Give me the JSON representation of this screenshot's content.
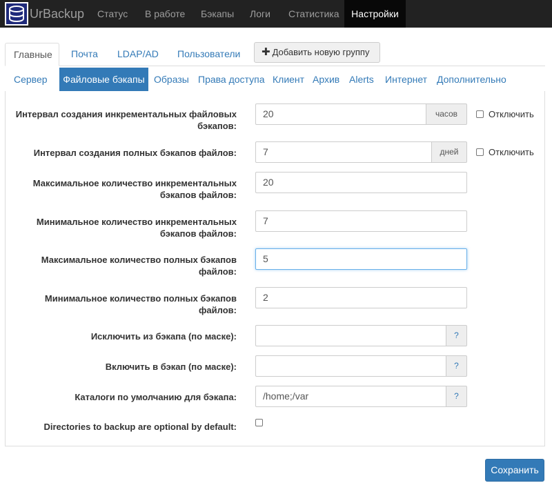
{
  "app": {
    "brand": "UrBackup"
  },
  "nav": {
    "items": [
      {
        "label": "Статус"
      },
      {
        "label": "В работе"
      },
      {
        "label": "Бэкапы"
      },
      {
        "label": "Логи"
      },
      {
        "label": "Статистика"
      },
      {
        "label": "Настройки",
        "active": true
      }
    ]
  },
  "tabs": [
    {
      "label": "Главные",
      "active": true
    },
    {
      "label": "Почта"
    },
    {
      "label": "LDAP/AD"
    },
    {
      "label": "Пользователи"
    }
  ],
  "add_group_button": {
    "label": "Добавить новую группу",
    "icon": "plus-icon"
  },
  "subtabs": [
    {
      "label": "Сервер"
    },
    {
      "label": "Файловые бэкапы",
      "active": true
    },
    {
      "label": "Образы"
    },
    {
      "label": "Права доступа"
    },
    {
      "label": "Клиент"
    },
    {
      "label": "Архив"
    },
    {
      "label": "Alerts"
    },
    {
      "label": "Интернет"
    },
    {
      "label": "Дополнительно"
    }
  ],
  "form": {
    "incr_interval": {
      "label_line1": "Интервал создания инкрементальных файловых",
      "label_line2": "бэкапов:",
      "value": "20",
      "unit": "часов",
      "disable_label": "Отключить",
      "disabled": false
    },
    "full_interval": {
      "label": "Интервал создания полных бэкапов файлов:",
      "value": "7",
      "unit": "дней",
      "disable_label": "Отключить",
      "disabled": false
    },
    "max_incr": {
      "label_line1": "Максимальное количество инкрементальных",
      "label_line2": "бэкапов файлов:",
      "value": "20"
    },
    "min_incr": {
      "label_line1": "Минимальное количество инкрементальных",
      "label_line2": "бэкапов файлов:",
      "value": "7"
    },
    "max_full": {
      "label_line1": "Максимальное количество полных бэкапов",
      "label_line2": "файлов:",
      "value": "5"
    },
    "min_full": {
      "label_line1": "Минимальное количество полных бэкапов",
      "label_line2": "файлов:",
      "value": "2"
    },
    "exclude": {
      "label": "Исключить из бэкапа (по маске):",
      "value": "",
      "help": "?"
    },
    "include": {
      "label": "Включить в бэкап (по маске):",
      "value": "",
      "help": "?"
    },
    "default_dirs": {
      "label": "Каталоги по умолчанию для бэкапа:",
      "value": "/home;/var",
      "help": "?"
    },
    "optional_dirs": {
      "label": "Directories to backup are optional by default:",
      "checked": false
    }
  },
  "save_button": {
    "label": "Сохранить"
  },
  "colors": {
    "navbar": "#222222",
    "navbar_active": "#080808",
    "accent": "#337ab7"
  }
}
